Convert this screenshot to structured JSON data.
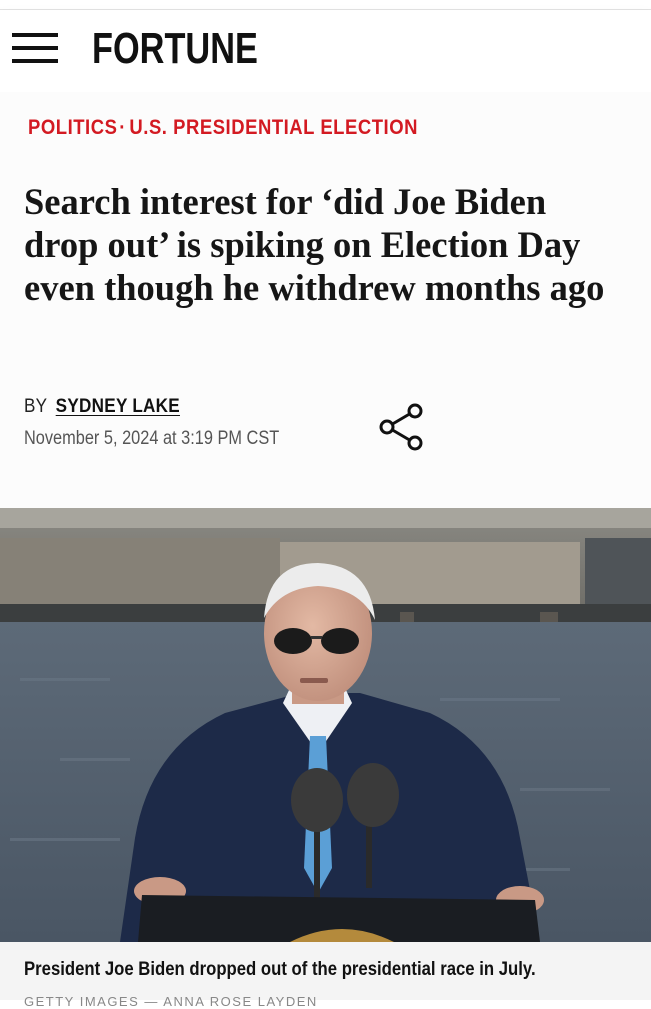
{
  "header": {
    "logo": "FORTUNE",
    "menu_icon": "hamburger-menu-icon"
  },
  "article": {
    "kicker": {
      "category": "POLITICS",
      "separator": "·",
      "topic": "U.S. PRESIDENTIAL ELECTION"
    },
    "headline": "Search interest for ‘did Joe Biden drop out’ is spiking on Election Day even though he withdrew months ago",
    "byline": {
      "prefix": "BY",
      "author": "SYDNEY LAKE"
    },
    "date": "November 5, 2024 at 3:19 PM CST",
    "share_icon": "share-icon"
  },
  "photo": {
    "caption": "President Joe Biden dropped out of the presidential race in July.",
    "credit": "GETTY IMAGES — ANNA ROSE LAYDEN"
  },
  "colors": {
    "accent_red": "#d31a22",
    "text_dark": "#161616",
    "suit_navy": "#1d2a48",
    "tie_blue": "#5b9fd6"
  }
}
